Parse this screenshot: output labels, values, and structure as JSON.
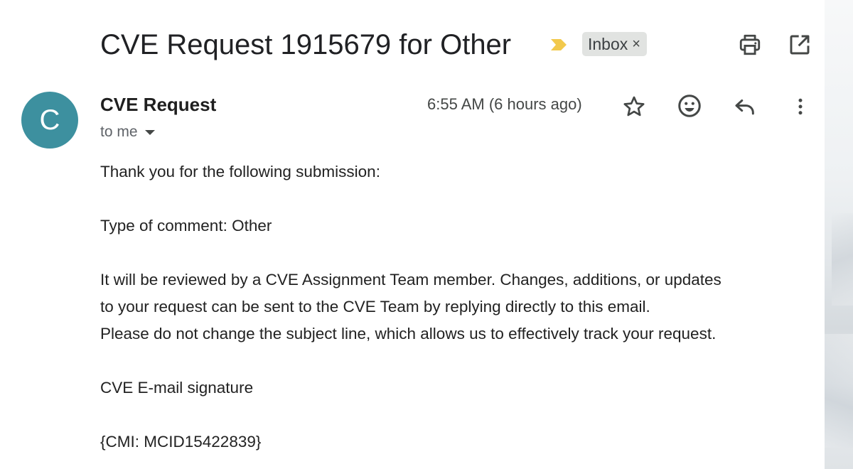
{
  "email": {
    "subject": "CVE Request 1915679 for Other",
    "label": "Inbox",
    "label_close": "×",
    "sender": {
      "avatar_letter": "C",
      "avatar_color": "#3d909f",
      "name": "CVE Request",
      "recipient": "to me"
    },
    "timestamp": "6:55 AM (6 hours ago)",
    "body": {
      "line1": "Thank you for the following submission:",
      "line2": "Type of comment: Other",
      "line3": "It will be reviewed by a CVE Assignment Team member. Changes, additions, or updates",
      "line4": "to your request can be sent to the CVE Team by replying directly to this email.",
      "line5": "Please do not change the subject line, which allows us to effectively track your request.",
      "line6": "CVE E-mail signature",
      "line7": "{CMI: MCID15422839}"
    }
  },
  "icons": {
    "importance": "importance-marker-icon",
    "print": "print-icon",
    "popout": "open-in-new-window-icon",
    "star": "star-icon",
    "emoji": "emoji-reaction-icon",
    "reply": "reply-icon",
    "more": "more-vertical-icon"
  },
  "colors": {
    "importance_marker": "#f2c94c",
    "label_chip_bg": "#e1e3e1"
  }
}
